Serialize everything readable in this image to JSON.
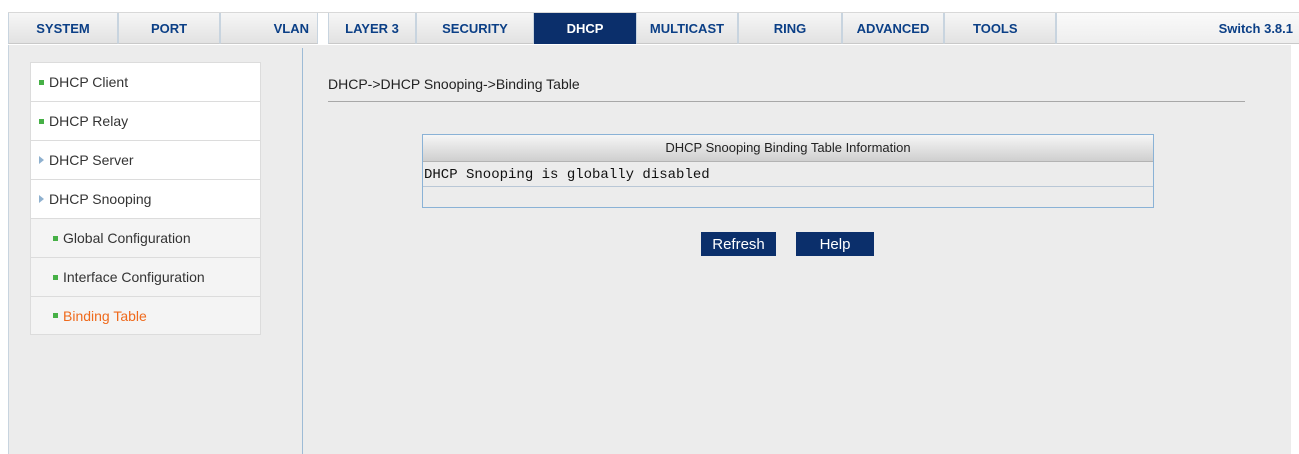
{
  "nav": {
    "tabs": [
      {
        "label": "SYSTEM"
      },
      {
        "label": "PORT"
      },
      {
        "label": "VLAN"
      },
      {
        "label": "LAYER 3"
      },
      {
        "label": "SECURITY"
      },
      {
        "label": "DHCP"
      },
      {
        "label": "MULTICAST"
      },
      {
        "label": "RING"
      },
      {
        "label": "ADVANCED"
      },
      {
        "label": "TOOLS"
      }
    ],
    "active_tab": "DHCP",
    "version": "Switch 3.8.1"
  },
  "sidebar": {
    "items": [
      {
        "label": "DHCP Client",
        "icon": "green-square-bullet"
      },
      {
        "label": "DHCP Relay",
        "icon": "green-square-bullet"
      },
      {
        "label": "DHCP Server",
        "icon": "expand-arrow"
      },
      {
        "label": "DHCP Snooping",
        "icon": "expand-arrow"
      },
      {
        "label": "Global Configuration",
        "icon": "green-square-bullet"
      },
      {
        "label": "Interface Configuration",
        "icon": "green-square-bullet"
      },
      {
        "label": "Binding Table",
        "icon": "green-square-bullet"
      }
    ],
    "current_item": "Binding Table"
  },
  "main": {
    "breadcrumb": "DHCP->DHCP Snooping->Binding Table",
    "table": {
      "title": "DHCP Snooping Binding Table Information",
      "message": "DHCP Snooping is globally disabled"
    },
    "buttons": {
      "refresh_label": "Refresh",
      "help_label": "Help"
    }
  },
  "colors": {
    "accent": "#0b2f6b",
    "current_item": "#ef6a1c",
    "bullet": "#46b046"
  }
}
